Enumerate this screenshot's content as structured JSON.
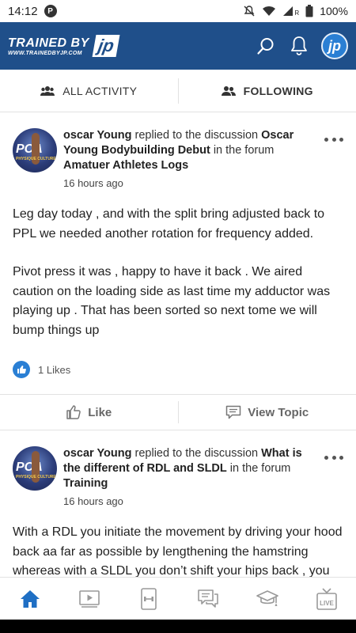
{
  "status_bar": {
    "time": "14:12",
    "app_indicator": "P",
    "battery": "100%",
    "signal_label": "R"
  },
  "header": {
    "brand_name": "TRAINED BY",
    "brand_url": "WWW.TRAINEDBYJP.COM",
    "brand_logo": "jp",
    "avatar_initials": "jp",
    "icons": [
      "search-icon",
      "bell-icon"
    ]
  },
  "tabs": [
    {
      "label": "ALL ACTIVITY",
      "icon": "group-icon",
      "active": false
    },
    {
      "label": "FOLLOWING",
      "icon": "people-icon",
      "active": true
    }
  ],
  "posts": [
    {
      "author": "oscar Young",
      "action_text": "replied to the discussion",
      "discussion": "Oscar Young Bodybuilding Debut",
      "forum_prefix": "in the forum",
      "forum": "Amatuer Athletes Logs",
      "time": "16 hours ago",
      "paragraphs": [
        "Leg day today , and with the split bring adjusted back to PPL we needed another rotation for frequency added.",
        "Pivot press it was , happy to have it back . We aired caution on the loading side as last time my adductor was playing up . That has been sorted so next tome we will bump things up"
      ],
      "likes": "1 Likes",
      "like_label": "Like",
      "view_label": "View Topic"
    },
    {
      "author": "oscar Young",
      "action_text": "replied to the discussion",
      "discussion": "What is the different of RDL and SLDL",
      "forum_prefix": "in the forum",
      "forum": "Training",
      "time": "16 hours ago",
      "paragraphs": [
        "With a RDL you initiate the movement by driving your hood back aa far as possible by lengthening the hamstring whereas with a SLDL you don’t shift your hips back , you just focus on hinging at the hip ."
      ]
    }
  ],
  "avatar_image": {
    "pca_text": "PCA",
    "pca_sub": "PHYSIQUE CULTURE"
  },
  "bottom_nav": [
    "home-icon",
    "video-icon",
    "workout-icon",
    "forum-icon",
    "courses-icon",
    "live-icon"
  ],
  "bottom_nav_live": "LIVE",
  "colors": {
    "brand": "#1f4f8a",
    "accent": "#2a7fd4",
    "active_nav": "#1f6fc4"
  }
}
